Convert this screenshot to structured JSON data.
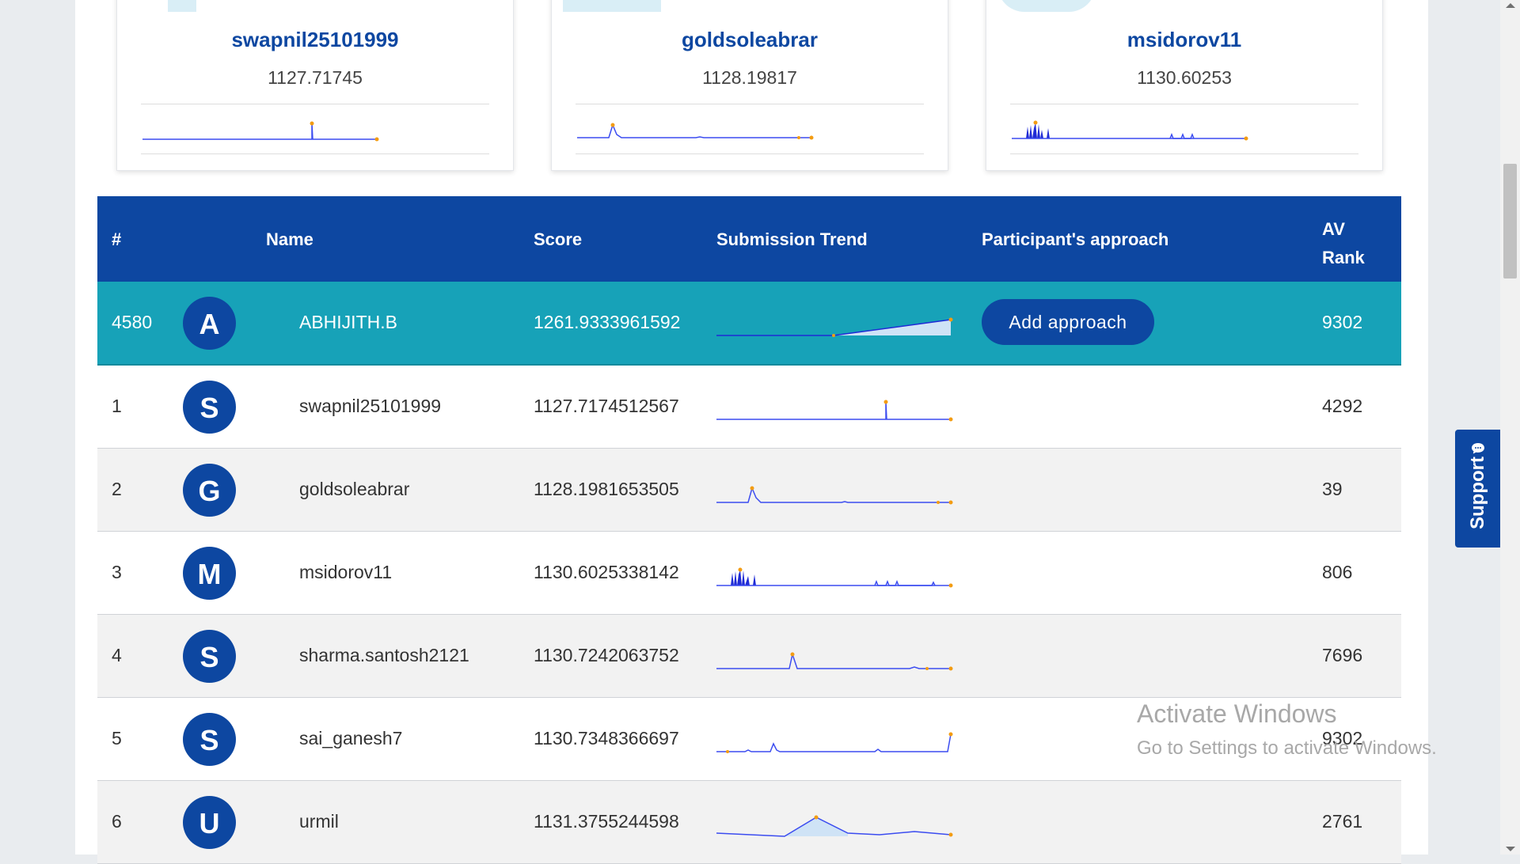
{
  "podium": [
    {
      "name": "swapnil25101999",
      "score": "1127.71745"
    },
    {
      "name": "goldsoleabrar",
      "score": "1128.19817"
    },
    {
      "name": "msidorov11",
      "score": "1130.60253"
    }
  ],
  "table": {
    "headers": {
      "rank": "#",
      "name": "Name",
      "score": "Score",
      "trend": "Submission Trend",
      "approach": "Participant's approach",
      "av_rank_line1": "AV",
      "av_rank_line2": "Rank"
    },
    "current_user": {
      "rank": "4580",
      "initial": "A",
      "name": "ABHIJITH.B",
      "score": "1261.9333961592",
      "approach_button": "Add approach",
      "av_rank": "9302"
    },
    "rows": [
      {
        "rank": "1",
        "initial": "S",
        "name": "swapnil25101999",
        "score": "1127.7174512567",
        "av_rank": "4292"
      },
      {
        "rank": "2",
        "initial": "G",
        "name": "goldsoleabrar",
        "score": "1128.1981653505",
        "av_rank": "39"
      },
      {
        "rank": "3",
        "initial": "M",
        "name": "msidorov11",
        "score": "1130.6025338142",
        "av_rank": "806"
      },
      {
        "rank": "4",
        "initial": "S",
        "name": "sharma.santosh2121",
        "score": "1130.7242063752",
        "av_rank": "7696"
      },
      {
        "rank": "5",
        "initial": "S",
        "name": "sai_ganesh7",
        "score": "1130.7348366697",
        "av_rank": "9302"
      },
      {
        "rank": "6",
        "initial": "U",
        "name": "urmil",
        "score": "1131.3755244598",
        "av_rank": "2761"
      }
    ]
  },
  "watermark": {
    "line1": "Activate Windows",
    "line2": "Go to Settings to activate Windows."
  },
  "support": {
    "label": "Support",
    "icon": "chat-bubble-icon"
  },
  "colors": {
    "primary": "#0d47a1",
    "highlight_row": "#17a2b8",
    "trend_line": "#3b4cf0",
    "trend_marker": "#f39c12"
  }
}
